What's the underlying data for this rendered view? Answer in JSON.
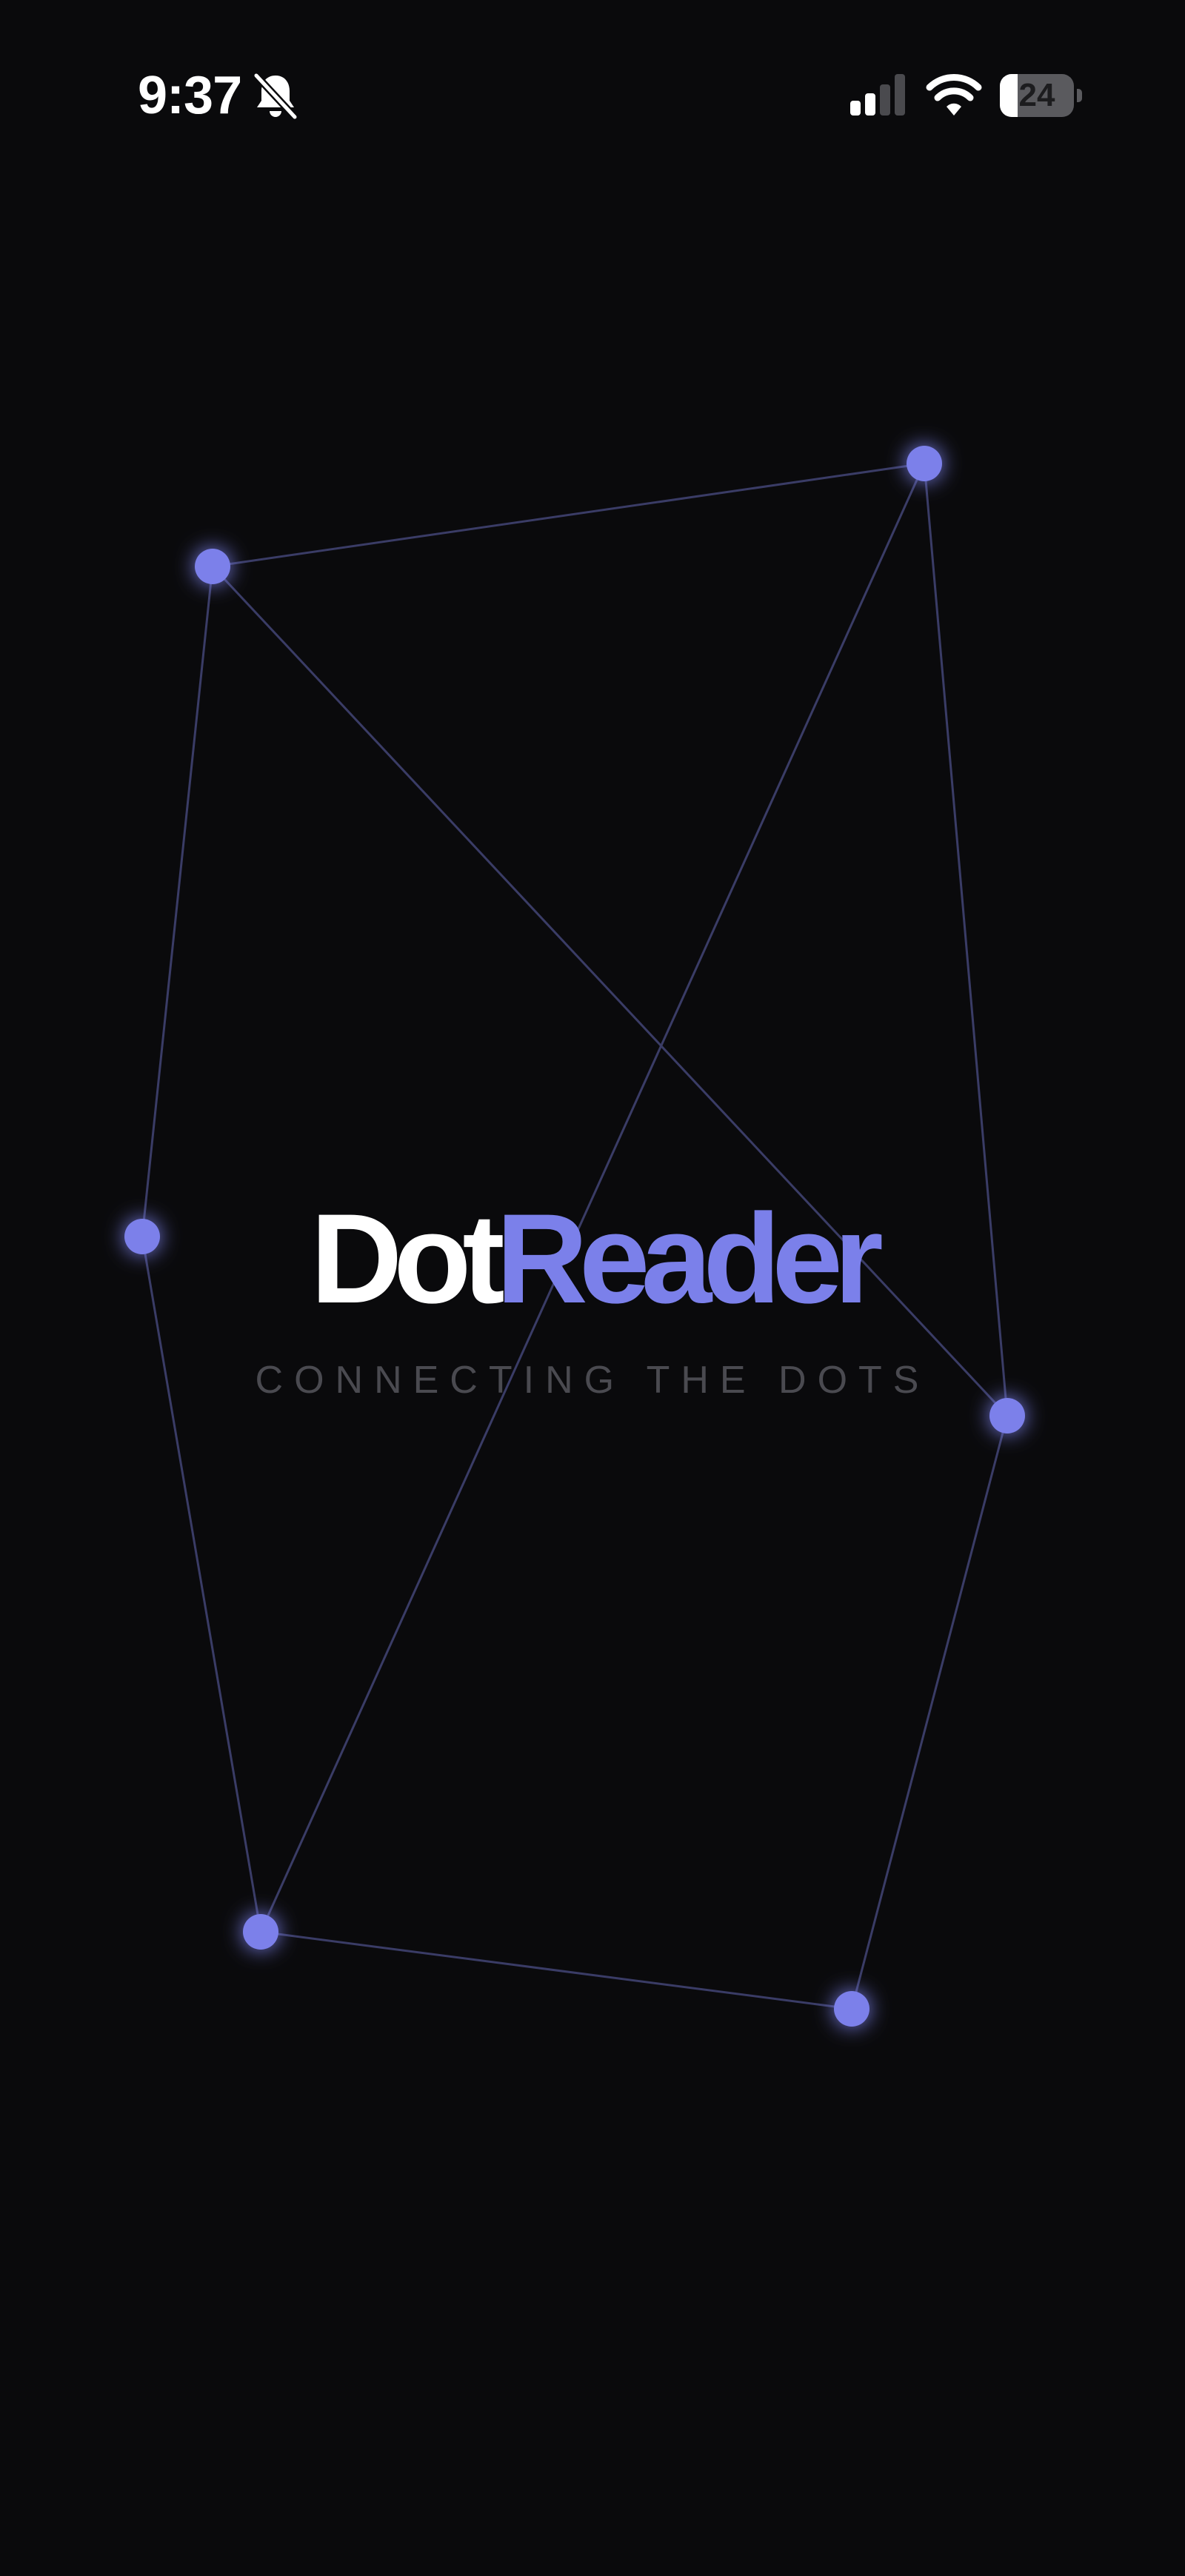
{
  "status_bar": {
    "time": "9:37",
    "battery_level": "24",
    "battery_percent": 24,
    "signal_bars_active": 2,
    "signal_bars_total": 4,
    "icons": [
      "bell-slash-icon",
      "cellular-signal-icon",
      "wifi-icon",
      "battery-icon"
    ]
  },
  "brand": {
    "name_part_1": "Dot",
    "name_part_2": "Reader",
    "tagline": "CONNECTING THE DOTS"
  },
  "colors": {
    "background": "#0a0a0c",
    "accent": "#7b80ea",
    "line": "#3a3c66",
    "tagline": "#4a4a50",
    "text": "#ffffff"
  }
}
